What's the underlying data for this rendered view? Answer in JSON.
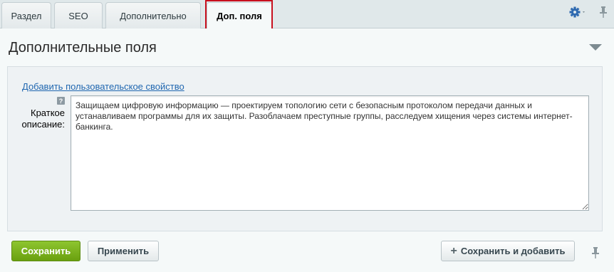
{
  "tabs": [
    {
      "label": "Раздел",
      "active": false
    },
    {
      "label": "SEO",
      "active": false
    },
    {
      "label": "Дополнительно",
      "active": false
    },
    {
      "label": "Доп. поля",
      "active": true
    }
  ],
  "toolbar": {
    "settings_icon": "gear-icon",
    "pin_icon": "pin-icon"
  },
  "section": {
    "title": "Дополнительные поля",
    "add_property_link": "Добавить пользовательское свойство",
    "help_icon_glyph": "?",
    "field": {
      "label": "Краткое описание:",
      "value": "Защищаем цифровую информацию — проектируем топологию сети с безопасным протоколом передачи данных и устанавливаем программы для их защиты. Разоблачаем преступные группы, расследуем хищения через системы интернет-банкинга."
    }
  },
  "buttons": {
    "save": "Сохранить",
    "apply": "Применить",
    "save_and_add": "Сохранить и добавить"
  },
  "colors": {
    "accent_green": "#6aa00f",
    "link_blue": "#2067b0",
    "highlight_red": "#c8101e",
    "gear_blue": "#2f6ab0"
  }
}
